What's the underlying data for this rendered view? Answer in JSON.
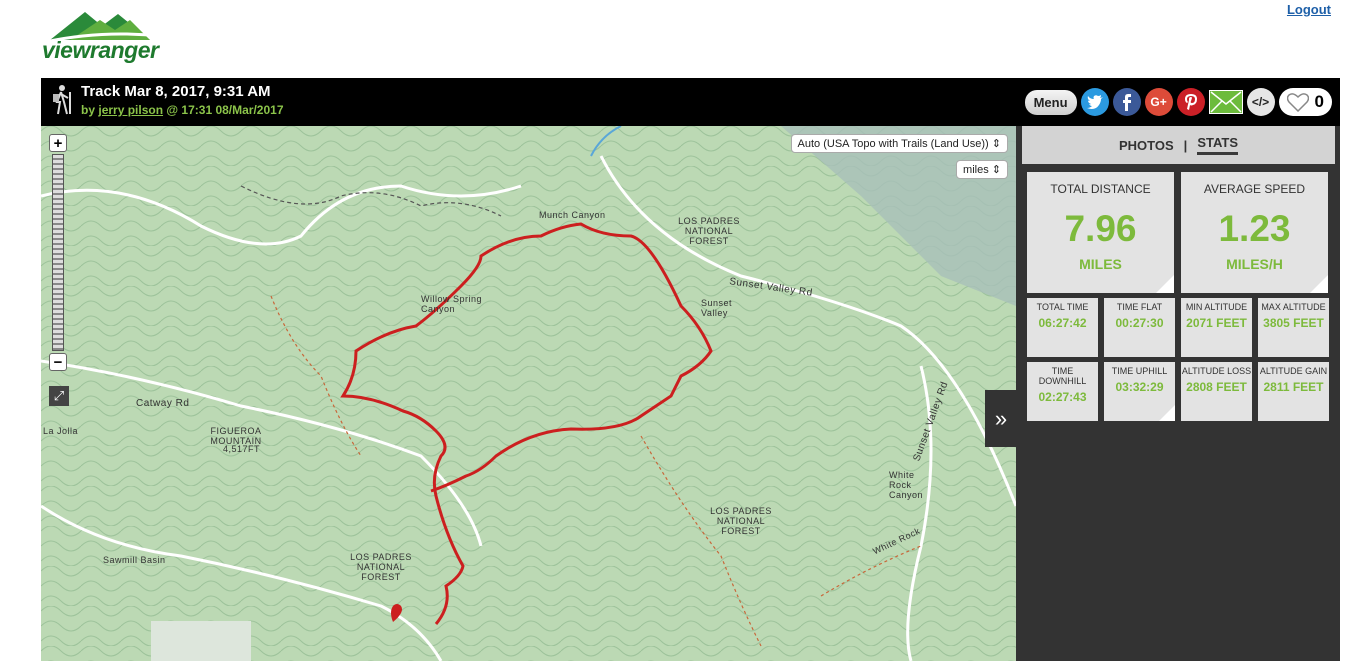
{
  "logo": {
    "text": "viewranger"
  },
  "nav": {
    "logout": "Logout"
  },
  "track": {
    "title": "Track Mar 8, 2017, 9:31 AM",
    "by": "by",
    "author": "jerry pilson",
    "at": "@ 17:31 08/Mar/2017"
  },
  "actions": {
    "menu": "Menu",
    "likes": "0",
    "icons": [
      "twitter-icon",
      "facebook-icon",
      "google-plus-icon",
      "pinterest-icon",
      "email-icon",
      "embed-icon",
      "heart-icon"
    ],
    "google_plus": "G+",
    "embed": "</>"
  },
  "map": {
    "layer": "Auto (USA Topo with Trails (Land Use))",
    "units": "miles",
    "zoom_in": "+",
    "zoom_out": "−",
    "labels": {
      "munch_canyon": "Munch Canyon",
      "lpnf_top": "LOS PADRES NATIONAL FOREST",
      "sunset_valley_rd": "Sunset Valley Rd",
      "sunset_valley": "Sunset Valley",
      "willow_spring": "Willow Spring Canyon",
      "catway": "Catway Rd",
      "figueroa": "FIGUEROA MOUNTAIN",
      "figueroa_elev": "4,517FT",
      "sawmill": "Sawmill Basin",
      "lpnf_left": "LOS PADRES NATIONAL FOREST",
      "lpnf_right": "LOS PADRES NATIONAL FOREST",
      "white_rock_canyon": "White Rock Canyon",
      "white_rock": "White Rock",
      "sunset_valley_rd2": "Sunset Valley Rd",
      "la_jolla": "La Jolla"
    }
  },
  "panel": {
    "tabs": [
      "PHOTOS",
      "STATS"
    ],
    "separator": "|",
    "active_tab": "STATS",
    "total_distance": {
      "label": "TOTAL DISTANCE",
      "value": "7.96",
      "unit": "MILES"
    },
    "average_speed": {
      "label": "AVERAGE SPEED",
      "value": "1.23",
      "unit": "MILES/H"
    },
    "stats": [
      {
        "label": "TOTAL TIME",
        "value": "06:27:42"
      },
      {
        "label": "TIME FLAT",
        "value": "00:27:30"
      },
      {
        "label": "MIN ALTITUDE",
        "value": "2071 FEET"
      },
      {
        "label": "MAX ALTITUDE",
        "value": "3805 FEET"
      },
      {
        "label": "TIME DOWNHILL",
        "value": "02:27:43"
      },
      {
        "label": "TIME UPHILL",
        "value": "03:32:29"
      },
      {
        "label": "ALTITUDE LOSS",
        "value": "2808 FEET"
      },
      {
        "label": "ALTITUDE GAIN",
        "value": "2811 FEET"
      }
    ]
  },
  "colors": {
    "accent": "#7dba3c",
    "track": "#cc1f1f",
    "header": "#000000",
    "panel": "#333333"
  }
}
